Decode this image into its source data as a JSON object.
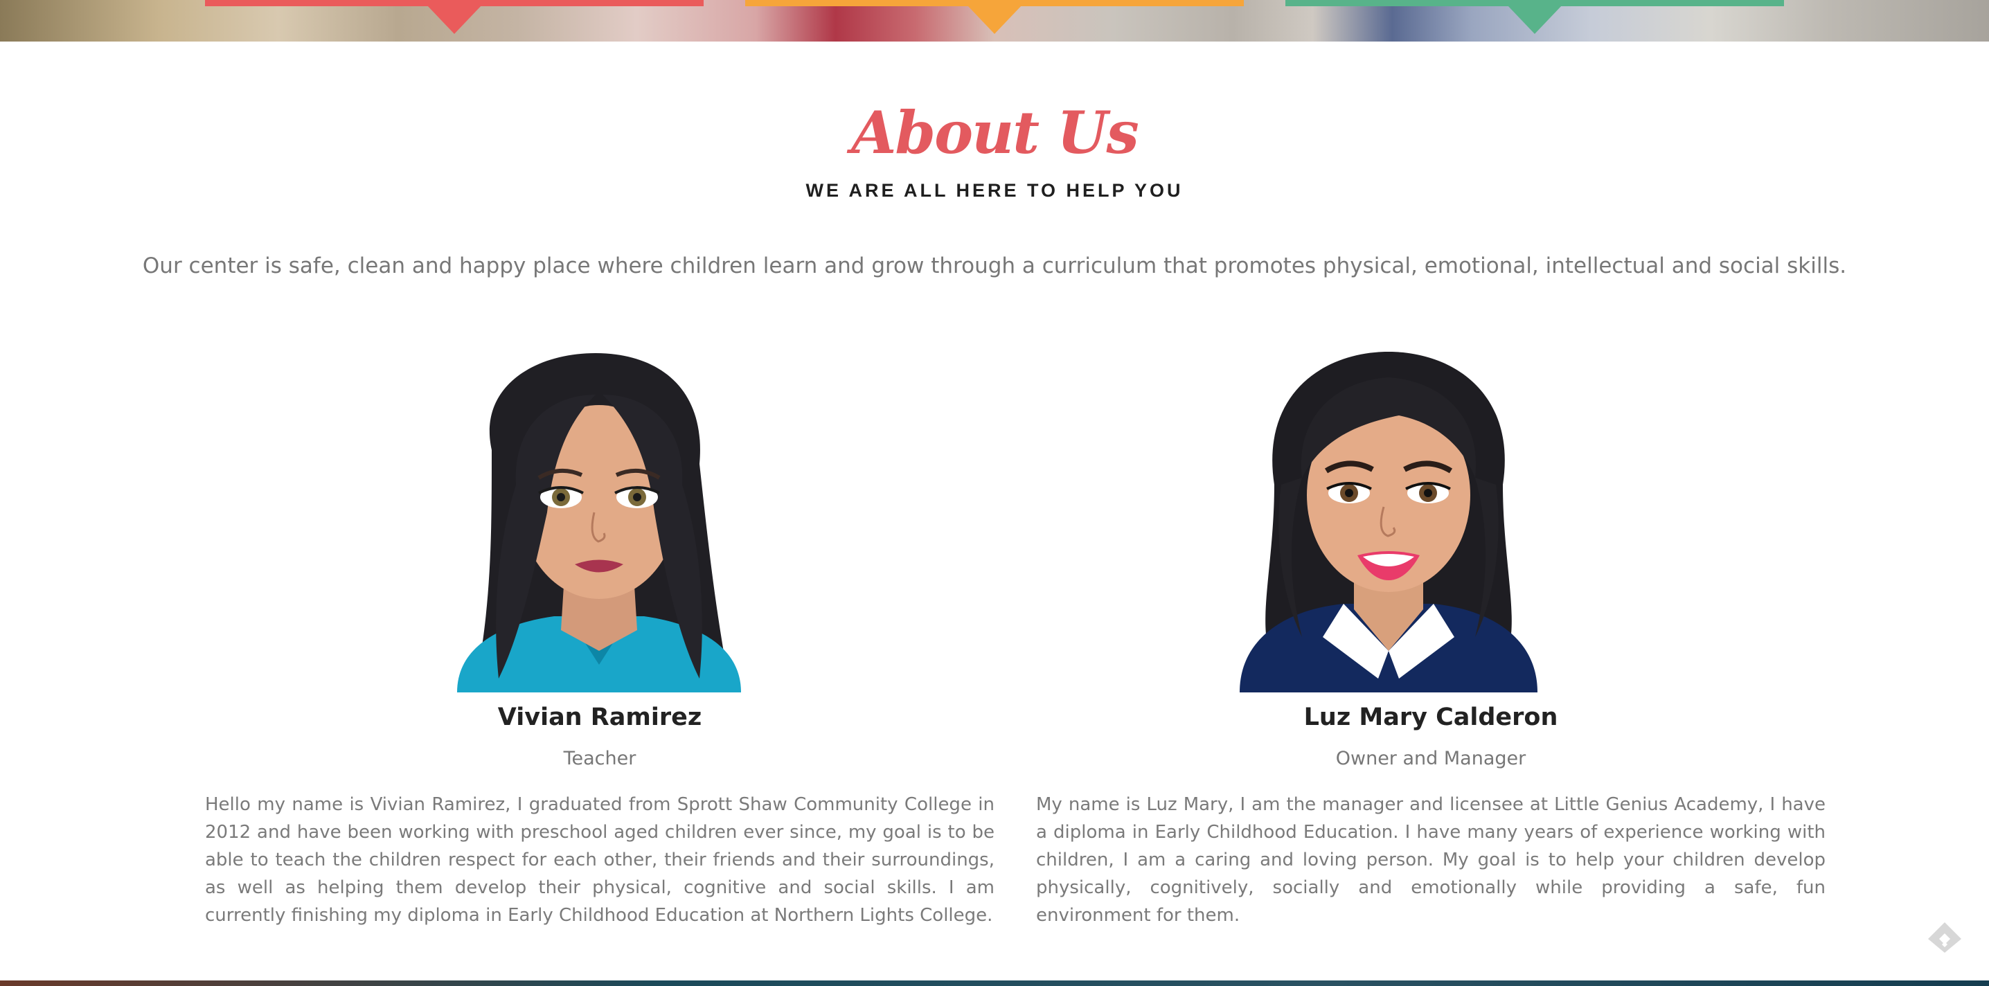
{
  "header": {
    "tab_colors": [
      "#ea5b5b",
      "#f6a53a",
      "#58b38a"
    ]
  },
  "about": {
    "title": "About Us",
    "subtitle": "WE ARE ALL HERE TO HELP YOU",
    "intro": "Our center is safe, clean and happy place where children learn and grow through a curriculum that promotes physical, emotional, intellectual and social skills."
  },
  "team": [
    {
      "name": "Vivian Ramirez",
      "role": "Teacher",
      "bio": "Hello my name is Vivian Ramirez, I graduated from Sprott Shaw Community College in 2012 and have been working with preschool aged children ever since, my goal is to be able to teach the children respect for each other, their friends and their surroundings, as well as helping them develop their physical, cognitive and social skills. I am currently finishing my diploma in Early Childhood Education at Northern Lights College."
    },
    {
      "name": "Luz Mary Calderon",
      "role": "Owner and Manager",
      "bio": "My name is Luz Mary, I am the manager and licensee at Little Genius Academy, I have a diploma in Early Childhood Education. I have many years of experience working with children, I am a caring and loving person. My goal is to help your children develop physically, cognitively, socially and emotionally while providing a safe, fun environment for them."
    }
  ],
  "colors": {
    "accent": "#e35a5f",
    "heading": "#222222",
    "body_text": "#7a7a7a"
  },
  "icons": [
    "avatar-vivian",
    "avatar-luz-mary",
    "feedly-icon"
  ]
}
